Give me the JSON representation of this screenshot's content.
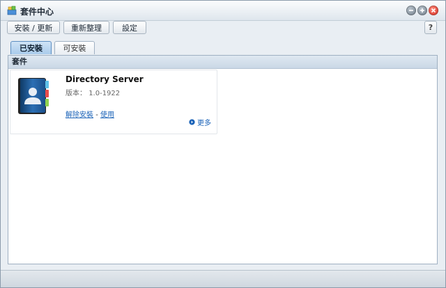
{
  "window": {
    "title": "套件中心",
    "icon": "package-center-icon",
    "controls": {
      "minimize": "minimize-icon",
      "maximize": "maximize-icon",
      "close": "close-icon"
    }
  },
  "toolbar": {
    "install_update_label": "安裝 / 更新",
    "refresh_label": "重新整理",
    "settings_label": "設定",
    "help_label": "?"
  },
  "tabs": [
    {
      "label": "已安裝",
      "active": true
    },
    {
      "label": "可安裝",
      "active": false
    }
  ],
  "section": {
    "header": "套件"
  },
  "packages": [
    {
      "name": "Directory Server",
      "version_label": "版本：",
      "version": "1.0-1922",
      "uninstall_label": "解除安裝",
      "separator": "-",
      "use_label": "使用",
      "more_label": "更多",
      "icon": "address-book-icon"
    }
  ],
  "colors": {
    "accent": "#1b63b8",
    "tab_active": "#a9cbeb",
    "close_button": "#d2271c"
  }
}
